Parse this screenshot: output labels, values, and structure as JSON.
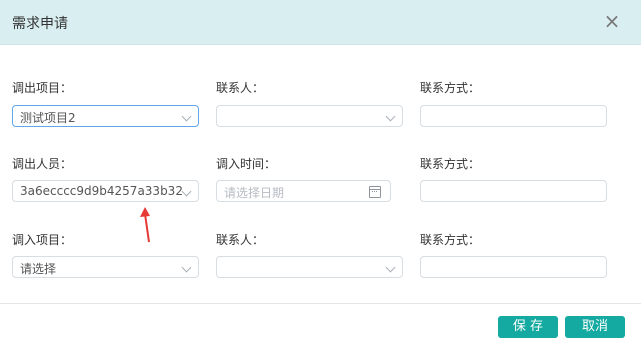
{
  "dialog": {
    "title": "需求申请",
    "close_icon": "close-icon",
    "buttons": {
      "save": "保 存",
      "cancel": "取消"
    }
  },
  "form": {
    "row1": {
      "out_project_label": "调出项目：",
      "out_project_value": "测试项目2",
      "out_contact_label": "联系人：",
      "out_contact_value": "",
      "out_phone_label": "联系方式：",
      "out_phone_value": ""
    },
    "row2": {
      "out_staff_label": "调出人员：",
      "out_staff_value": "3a6ecccc9d9b4257a33b328...",
      "in_time_label": "调入时间：",
      "in_time_placeholder": "请选择日期",
      "in_phone_label": "联系方式：",
      "in_phone_value": ""
    },
    "row3": {
      "in_project_label": "调入项目：",
      "in_project_placeholder": "请选择",
      "in_contact_label": "联系人：",
      "in_contact_value": "",
      "in_phone_label": "联系方式：",
      "in_phone_value": ""
    }
  },
  "annotations": {
    "arrow_color": "#e53935",
    "icon": "arrow-up-icon"
  },
  "colors": {
    "header_background": "#d8eef0",
    "button_primary": "#14aaa1",
    "active_border": "#63a6e8"
  }
}
